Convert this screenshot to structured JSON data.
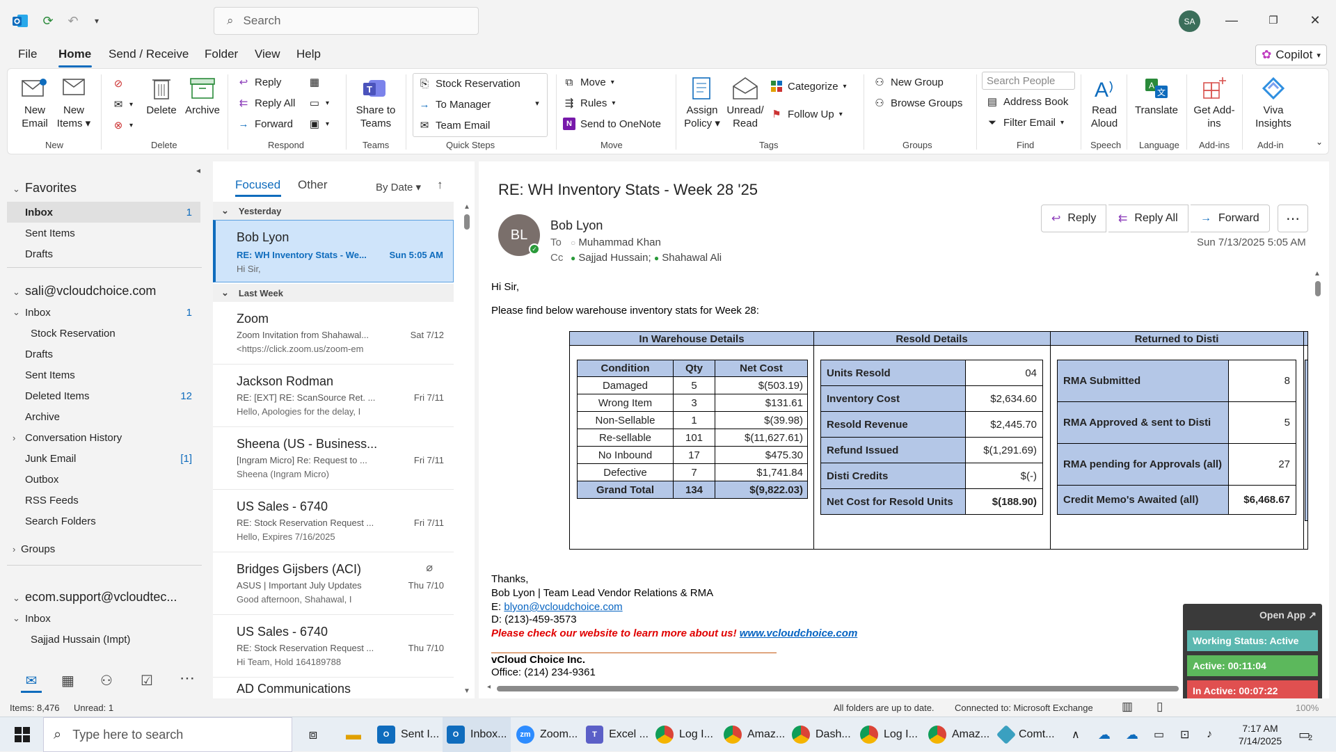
{
  "titlebar": {
    "search_placeholder": "Search",
    "avatar_initials": "SA"
  },
  "menu": {
    "tabs": [
      "File",
      "Home",
      "Send / Receive",
      "Folder",
      "View",
      "Help"
    ],
    "active_tab": "Home",
    "copilot_label": "Copilot"
  },
  "ribbon": {
    "new_email": "New Email",
    "new_items": "New Items",
    "delete": "Delete",
    "archive": "Archive",
    "reply": "Reply",
    "reply_all": "Reply All",
    "forward": "Forward",
    "share_teams": "Share to Teams",
    "qs_stock": "Stock Reservation",
    "qs_manager": "To Manager",
    "qs_team": "Team Email",
    "move": "Move",
    "rules": "Rules",
    "onenote": "Send to OneNote",
    "assign_policy": "Assign Policy",
    "unread_read": "Unread/ Read",
    "categorize": "Categorize",
    "follow_up": "Follow Up",
    "new_group": "New Group",
    "browse_groups": "Browse Groups",
    "search_people": "Search People",
    "address_book": "Address Book",
    "filter_email": "Filter Email",
    "read_aloud": "Read Aloud",
    "translate": "Translate",
    "get_addins": "Get Add-ins",
    "viva": "Viva Insights",
    "groups": [
      "New",
      "Delete",
      "Respond",
      "Teams",
      "Quick Steps",
      "Move",
      "Tags",
      "Groups",
      "Find",
      "Speech",
      "Language",
      "Add-ins",
      "Add-in"
    ]
  },
  "folders": {
    "favorites": "Favorites",
    "fav_inbox": "Inbox",
    "fav_inbox_count": "1",
    "fav_sent": "Sent Items",
    "fav_drafts": "Drafts",
    "account1": "sali@vcloudchoice.com",
    "inbox": "Inbox",
    "inbox_count": "1",
    "stock_reservation": "Stock Reservation",
    "drafts": "Drafts",
    "sent": "Sent Items",
    "deleted": "Deleted Items",
    "deleted_count": "12",
    "archive": "Archive",
    "conv_history": "Conversation History",
    "junk": "Junk Email",
    "junk_count": "[1]",
    "outbox": "Outbox",
    "rss": "RSS Feeds",
    "search_folders": "Search Folders",
    "groups": "Groups",
    "account2": "ecom.support@vcloudtec...",
    "inbox2": "Inbox",
    "sajjad": "Sajjad Hussain (Impt)"
  },
  "msglist": {
    "tab_focused": "Focused",
    "tab_other": "Other",
    "sort_label": "By Date",
    "group_yesterday": "Yesterday",
    "group_lastweek": "Last Week",
    "items": [
      {
        "from": "Bob Lyon",
        "subject": "RE: WH Inventory Stats - We...",
        "date": "Sun 5:05 AM",
        "preview": "Hi Sir,"
      },
      {
        "from": "Zoom",
        "subject": "Zoom Invitation from Shahawal...",
        "date": "Sat 7/12",
        "preview": "<https://click.zoom.us/zoom-em"
      },
      {
        "from": "Jackson Rodman",
        "subject": "RE: [EXT] RE: ScanSource Ret. ...",
        "date": "Fri 7/11",
        "preview": "Hello,  Apologies for the delay, I"
      },
      {
        "from": "Sheena (US - Business...",
        "subject": "[Ingram Micro] Re: Request to ...",
        "date": "Fri 7/11",
        "preview": "Sheena (Ingram Micro)"
      },
      {
        "from": "US Sales - 6740",
        "subject": "RE: Stock Reservation Request ...",
        "date": "Fri 7/11",
        "preview": "Hello,  Expires 7/16/2025"
      },
      {
        "from": "Bridges Gijsbers (ACI)",
        "subject": "ASUS | Important July Updates",
        "date": "Thu 7/10",
        "preview": "Good afternoon, Shahawal,    I"
      },
      {
        "from": "US Sales - 6740",
        "subject": "RE: Stock Reservation Request ...",
        "date": "Thu 7/10",
        "preview": "Hi Team,  Hold 164189788"
      },
      {
        "from": "AD Communications",
        "subject": "",
        "date": "",
        "preview": ""
      }
    ]
  },
  "email": {
    "subject": "RE: WH Inventory Stats - Week 28 '25",
    "sender_initials": "BL",
    "sender": "Bob Lyon",
    "to_label": "To",
    "to": "Muhammad Khan",
    "cc_label": "Cc",
    "cc1": "Sajjad Hussain;",
    "cc2": "Shahawal Ali",
    "datetime": "Sun 7/13/2025 5:05 AM",
    "btn_reply": "Reply",
    "btn_reply_all": "Reply All",
    "btn_forward": "Forward",
    "greeting": "Hi Sir,",
    "intro": "Please find below warehouse inventory stats for Week 28:",
    "sec1_title": "In Warehouse Details",
    "sec2_title": "Resold Details",
    "sec3_title": "Returned to Disti",
    "wh_headers": [
      "Condition",
      "Qty",
      "Net Cost"
    ],
    "wh_rows": [
      [
        "Damaged",
        "5",
        "$(503.19)"
      ],
      [
        "Wrong Item",
        "3",
        "$131.61"
      ],
      [
        "Non-Sellable",
        "1",
        "$(39.98)"
      ],
      [
        "Re-sellable",
        "101",
        "$(11,627.61)"
      ],
      [
        "No Inbound",
        "17",
        "$475.30"
      ],
      [
        "Defective",
        "7",
        "$1,741.84"
      ]
    ],
    "wh_total": [
      "Grand Total",
      "134",
      "$(9,822.03)"
    ],
    "resold_rows": [
      [
        "Units Resold",
        "04"
      ],
      [
        "Inventory Cost",
        "$2,634.60"
      ],
      [
        "Resold Revenue",
        "$2,445.70"
      ],
      [
        "Refund Issued",
        "$(1,291.69)"
      ],
      [
        "Disti Credits",
        "$(-)"
      ],
      [
        "Net Cost for Resold Units",
        "$(188.90)"
      ]
    ],
    "disti_rows": [
      [
        "RMA Submitted",
        "8"
      ],
      [
        "RMA Approved & sent to Disti",
        "5"
      ],
      [
        "RMA pending for Approvals (all)",
        "27"
      ],
      [
        "Credit Memo's Awaited (all)",
        "$6,468.67"
      ]
    ],
    "thanks": "Thanks,",
    "sig_name": "Bob Lyon | Team Lead Vendor Relations & RMA",
    "sig_email_label": "E:",
    "sig_email": "blyon@vcloudchoice.com",
    "sig_phone": "D: (213)-459-3573",
    "sig_promo": "Please check our website to learn more about us!",
    "sig_site": "www.vcloudchoice.com",
    "sig_company": "vCloud Choice Inc.",
    "sig_office": "Office: (214) 234-9361"
  },
  "widget": {
    "open_app": "Open App",
    "status": "Working Status: Active",
    "active": "Active: 00:11:04",
    "inactive": "In Active: 00:07:22"
  },
  "statusbar": {
    "items": "Items: 8,476",
    "unread": "Unread: 1",
    "sync": "All folders are up to date.",
    "connected": "Connected to: Microsoft Exchange",
    "zoom": "100%"
  },
  "taskbar": {
    "search_placeholder": "Type here to search",
    "apps": [
      "Sent I...",
      "Inbox...",
      "Zoom...",
      "Excel ...",
      "Log I...",
      "Amaz...",
      "Dash...",
      "Log I...",
      "Amaz...",
      "Comt..."
    ],
    "time": "7:17 AM",
    "date": "7/14/2025",
    "notif_count": "2"
  },
  "colors": {
    "accent": "#0f6cbd",
    "selected_item": "#cfe4fa",
    "table_header": "#b4c7e7",
    "widget_green": "#5cb85c",
    "widget_red": "#e05050",
    "widget_teal": "#5bb8b0"
  }
}
